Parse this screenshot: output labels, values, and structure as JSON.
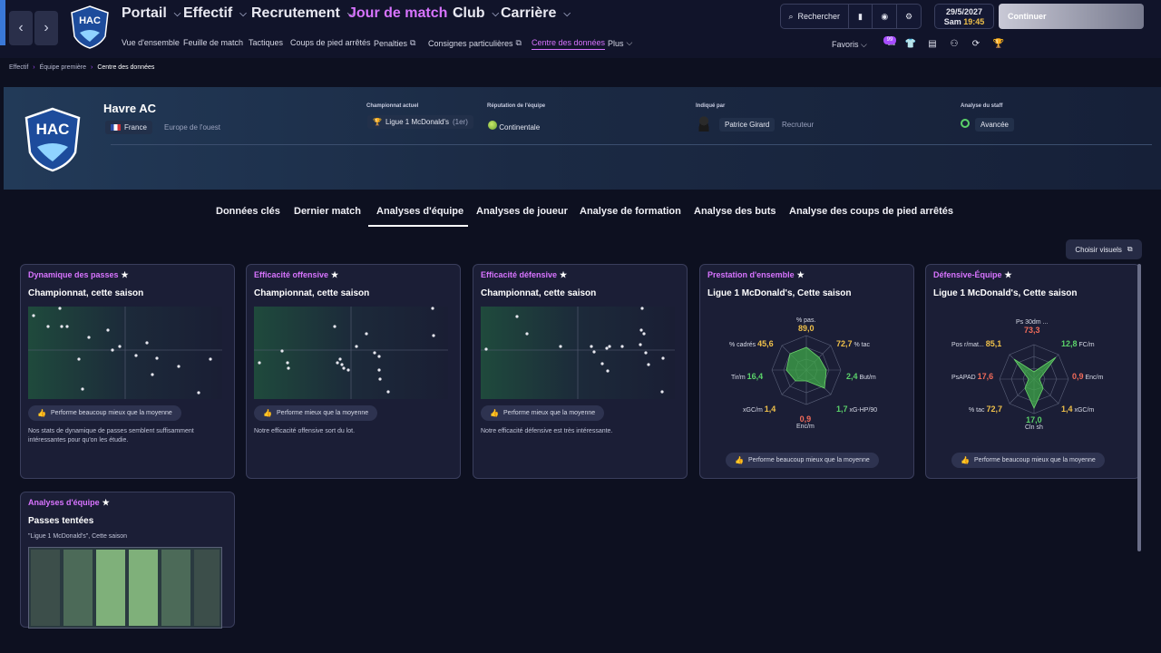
{
  "nav": {
    "main": [
      {
        "label": "Portail"
      },
      {
        "label": "Effectif"
      },
      {
        "label": "Recrutement"
      },
      {
        "label": "Jour de match"
      },
      {
        "label": "Club"
      },
      {
        "label": "Carrière"
      }
    ],
    "sub": [
      {
        "label": "Vue d'ensemble"
      },
      {
        "label": "Feuille de match"
      },
      {
        "label": "Tactiques"
      },
      {
        "label": "Coups de pied arrêtés"
      },
      {
        "label": "Penalties"
      },
      {
        "label": "Consignes particulières"
      },
      {
        "label": "Centre des données"
      },
      {
        "label": "Plus"
      }
    ]
  },
  "toolbar": {
    "search_label": "Rechercher",
    "date": "29/5/2027",
    "day": "Sam",
    "time": "19:45",
    "continue_label": "Continuer",
    "favorites_label": "Favoris",
    "badge": "99"
  },
  "breadcrumb": [
    "Effectif",
    "Équipe première",
    "Centre des données"
  ],
  "club": {
    "name": "Havre AC",
    "country": "France",
    "region": "Europe de l'ouest",
    "crest_text": "HAC",
    "labels": {
      "league": "Championnat actuel",
      "reputation": "Réputation de l'équipe",
      "indicated": "Indiqué par",
      "staff": "Analyse du staff"
    },
    "league": "Ligue 1 McDonald's",
    "league_pos": "(1er)",
    "reputation": "Continentale",
    "scout_name": "Patrice Girard",
    "scout_role": "Recruteur",
    "staff_level": "Avancée"
  },
  "tabs": [
    {
      "label": "Données clés"
    },
    {
      "label": "Dernier match"
    },
    {
      "label": "Analyses d'équipe"
    },
    {
      "label": "Analyses de joueur"
    },
    {
      "label": "Analyse de formation"
    },
    {
      "label": "Analyse des buts"
    },
    {
      "label": "Analyse des coups de pied arrêtés"
    }
  ],
  "choose_visuals": "Choisir visuels",
  "cards": [
    {
      "title": "Dynamique des passes",
      "subtitle": "Championnat, cette saison",
      "perf": "Performe beaucoup mieux que la moyenne",
      "desc": "Nos stats de dynamique de passes semblent suffisamment intéressantes pour qu'on les étudie."
    },
    {
      "title": "Efficacité offensive",
      "subtitle": "Championnat, cette saison",
      "perf": "Performe mieux que la moyenne",
      "desc": "Notre efficacité offensive sort du lot."
    },
    {
      "title": "Efficacité défensive",
      "subtitle": "Championnat, cette saison",
      "perf": "Performe mieux que la moyenne",
      "desc": "Notre efficacité défensive est très intéressante."
    },
    {
      "title": "Prestation d'ensemble",
      "subtitle": "Ligue 1 McDonald's, Cette saison",
      "perf": "Performe beaucoup mieux que la moyenne",
      "radar": [
        {
          "label": "% pas.",
          "value": "89,0",
          "tone": "y"
        },
        {
          "label": "% tac",
          "value": "72,7",
          "tone": "y"
        },
        {
          "label": "But/m",
          "value": "2,4",
          "tone": "g"
        },
        {
          "label": "xG-HP/90",
          "value": "1,7",
          "tone": "g"
        },
        {
          "label": "Enc/m",
          "value": "0,9",
          "tone": "r"
        },
        {
          "label": "xGC/m",
          "value": "1,4",
          "tone": "y"
        },
        {
          "label": "Tir/m",
          "value": "16,4",
          "tone": "g"
        },
        {
          "label": "% cadrés",
          "value": "45,6",
          "tone": "y"
        }
      ]
    },
    {
      "title": "Défensive-Équipe",
      "subtitle": "Ligue 1 McDonald's, Cette saison",
      "perf": "Performe beaucoup mieux que la moyenne",
      "radar": [
        {
          "label": "Ps 30dm ...",
          "value": "73,3",
          "tone": "r"
        },
        {
          "label": "FC/m",
          "value": "12,8",
          "tone": "g"
        },
        {
          "label": "Enc/m",
          "value": "0,9",
          "tone": "r"
        },
        {
          "label": "xGC/m",
          "value": "1,4",
          "tone": "y"
        },
        {
          "label": "Cln sh",
          "value": "17,0",
          "tone": "g"
        },
        {
          "label": "% tac",
          "value": "72,7",
          "tone": "y"
        },
        {
          "label": "PsAPAD",
          "value": "17,6",
          "tone": "r"
        },
        {
          "label": "Pos r/mat...",
          "value": "85,1",
          "tone": "y"
        }
      ]
    },
    {
      "title": "Analyses d'équipe",
      "subtitle": "Passes tentées",
      "caption": "\"Ligue 1 McDonald's\", Cette saison"
    }
  ],
  "colors": {
    "accent": "#d874ff",
    "positive": "#5bd36a",
    "warning": "#f0c14a",
    "negative": "#f26b5a"
  }
}
